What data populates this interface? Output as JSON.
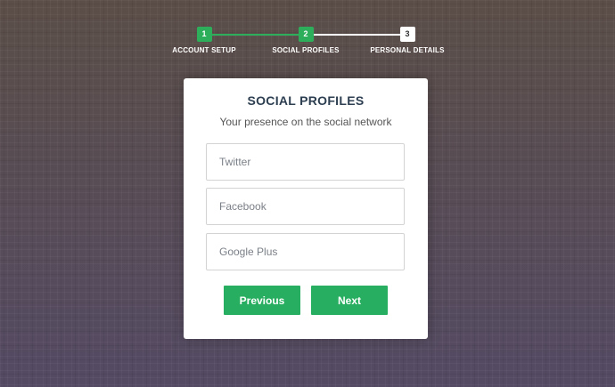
{
  "progress": {
    "steps": [
      {
        "number": "1",
        "label": "ACCOUNT SETUP"
      },
      {
        "number": "2",
        "label": "SOCIAL PROFILES"
      },
      {
        "number": "3",
        "label": "PERSONAL DETAILS"
      }
    ],
    "active_step": 2
  },
  "form": {
    "title": "SOCIAL PROFILES",
    "subtitle": "Your presence on the social network",
    "fields": [
      {
        "placeholder": "Twitter",
        "value": ""
      },
      {
        "placeholder": "Facebook",
        "value": ""
      },
      {
        "placeholder": "Google Plus",
        "value": ""
      }
    ],
    "previous_label": "Previous",
    "next_label": "Next"
  },
  "colors": {
    "accent": "#2dae5b",
    "button": "#27ae60",
    "title": "#2c3e50"
  }
}
